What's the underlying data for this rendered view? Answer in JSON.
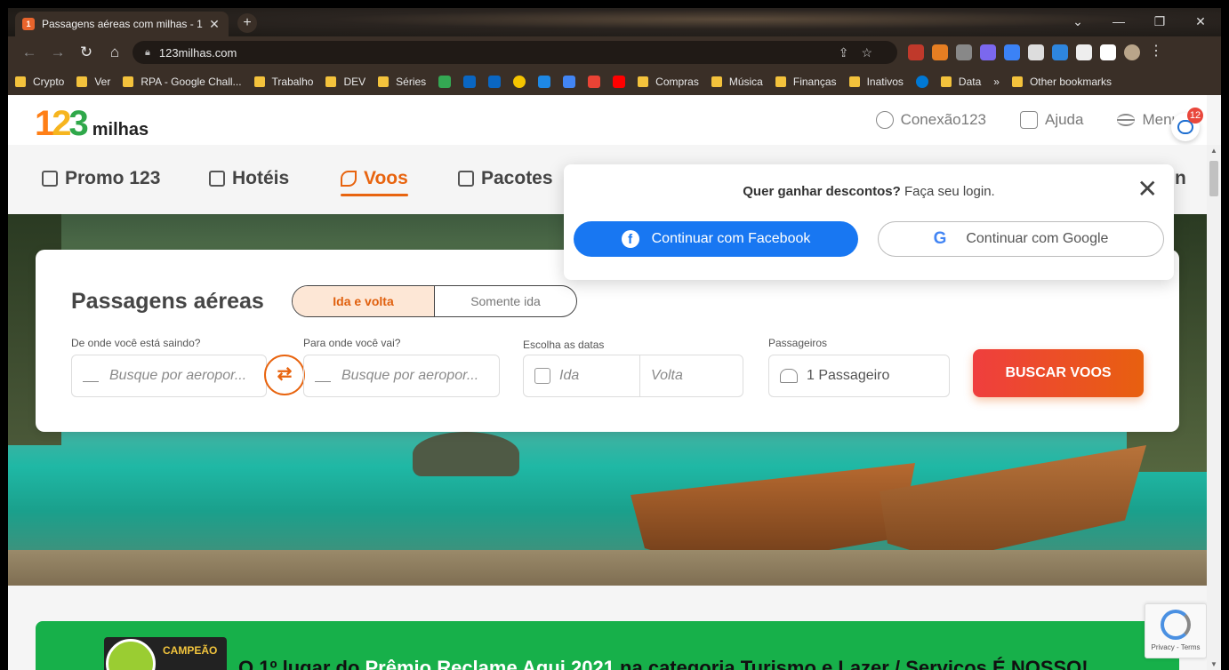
{
  "browser": {
    "tab_title": "Passagens aéreas com milhas - 1",
    "tab_close": "✕",
    "new_tab": "+",
    "url": "123milhas.com",
    "window_controls": [
      "⌄",
      "—",
      "❐",
      "✕"
    ],
    "bookmarks": [
      "Crypto",
      "Ver",
      "RPA - Google Chall...",
      "Trabalho",
      "DEV",
      "Séries"
    ],
    "bookmarks_right": [
      "Compras",
      "Música",
      "Finanças",
      "Inativos",
      "Data"
    ],
    "overflow": "»",
    "other_bookmarks": "Other bookmarks"
  },
  "header": {
    "logo_digits": [
      "1",
      "2",
      "3"
    ],
    "logo_text": "milhas",
    "links": [
      "Conexão123",
      "Ajuda",
      "Menu"
    ],
    "chat_badge": "12"
  },
  "nav": {
    "items": [
      "Promo 123",
      "Hotéis",
      "Voos",
      "Pacotes"
    ],
    "partial_item": "n",
    "active": "Voos"
  },
  "search": {
    "title": "Passagens aéreas",
    "trip_types": [
      "Ida e volta",
      "Somente ida"
    ],
    "origin_label": "De onde você está saindo?",
    "origin_placeholder": "Busque por aeropor...",
    "dest_label": "Para onde você vai?",
    "dest_placeholder": "Busque por aeropor...",
    "dates_label": "Escolha as datas",
    "depart_placeholder": "Ida",
    "return_placeholder": "Volta",
    "pax_label": "Passageiros",
    "pax_value": "1 Passageiro",
    "submit": "BUSCAR VOOS"
  },
  "login_popup": {
    "msg_bold": "Quer ganhar descontos?",
    "msg_rest": " Faça seu login.",
    "facebook": "Continuar com Facebook",
    "google": "Continuar com Google",
    "close": "✕"
  },
  "banner": {
    "seal_label": "CAMPEÃO",
    "text_a": "O 1º lugar do ",
    "text_b": "Prêmio Reclame Aqui 2021",
    "text_c": " na categoria Turismo e Lazer / Serviços É NOSSO!"
  },
  "recaptcha": {
    "text": "Privacy - Terms"
  },
  "colors": {
    "brand_orange": "#e8640f",
    "facebook": "#1877f2",
    "banner_green": "#17b04a"
  }
}
